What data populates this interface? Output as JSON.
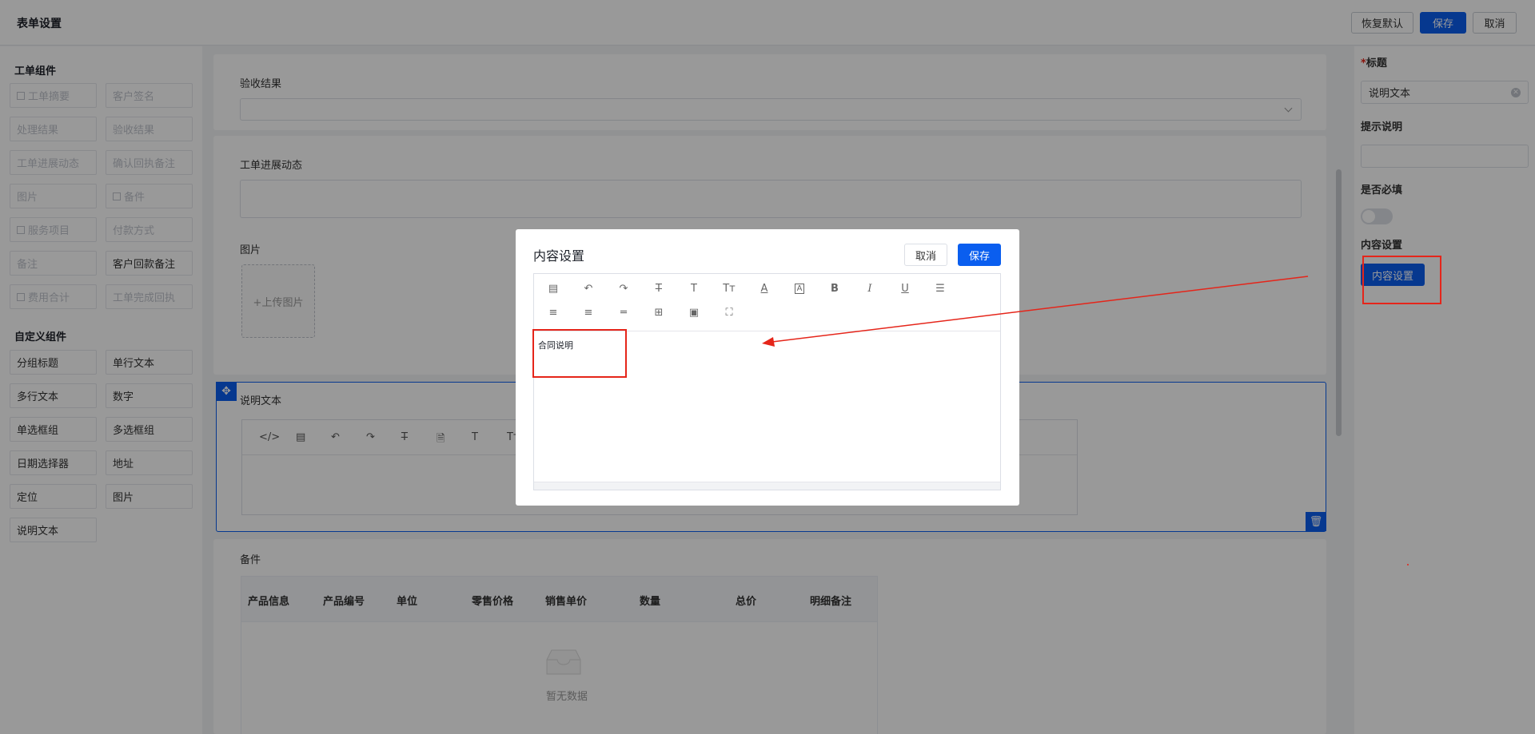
{
  "header": {
    "title": "表单设置",
    "restore_label": "恢复默认",
    "save_label": "保存",
    "cancel_label": "取消"
  },
  "left": {
    "workorder_section": "工单组件",
    "workorder_items": [
      {
        "label": "工单摘要",
        "disabled": true,
        "icon": true
      },
      {
        "label": "客户签名",
        "disabled": true,
        "icon": false
      },
      {
        "label": "处理结果",
        "disabled": true,
        "icon": false
      },
      {
        "label": "验收结果",
        "disabled": true,
        "icon": false
      },
      {
        "label": "工单进展动态",
        "disabled": true,
        "icon": false
      },
      {
        "label": "确认回执备注",
        "disabled": true,
        "icon": false
      },
      {
        "label": "图片",
        "disabled": true,
        "icon": false
      },
      {
        "label": "备件",
        "disabled": true,
        "icon": true
      },
      {
        "label": "服务项目",
        "disabled": true,
        "icon": true
      },
      {
        "label": "付款方式",
        "disabled": true,
        "icon": false
      },
      {
        "label": "备注",
        "disabled": true,
        "icon": false
      },
      {
        "label": "客户回款备注",
        "disabled": false,
        "icon": false
      },
      {
        "label": "费用合计",
        "disabled": true,
        "icon": true
      },
      {
        "label": "工单完成回执",
        "disabled": true,
        "icon": false
      }
    ],
    "custom_section": "自定义组件",
    "custom_items": [
      "分组标题",
      "单行文本",
      "多行文本",
      "数字",
      "单选框组",
      "多选框组",
      "日期选择器",
      "地址",
      "定位",
      "图片",
      "说明文本"
    ]
  },
  "canvas": {
    "acceptance_label": "验收结果",
    "progress_label": "工单进展动态",
    "image_label": "图片",
    "upload_label": "+上传图片",
    "desc_label": "说明文本",
    "parts_label": "备件",
    "table_headers": [
      "产品信息",
      "产品编号",
      "单位",
      "零售价格",
      "销售单价",
      "数量",
      "总价",
      "明细备注"
    ],
    "empty_text": "暂无数据"
  },
  "right": {
    "title_label": "标题",
    "title_value": "说明文本",
    "hint_label": "提示说明",
    "hint_value": "",
    "required_label": "是否必填",
    "required_on": false,
    "content_label": "内容设置",
    "content_button": "内容设置"
  },
  "dialog": {
    "title": "内容设置",
    "cancel_label": "取消",
    "save_label": "保存",
    "content_text": "合同说明",
    "toolbar_icons": [
      "template-icon",
      "undo-icon",
      "redo-icon",
      "strikethrough-icon",
      "font-size-icon",
      "clear-format-icon",
      "font-color-icon",
      "background-color-icon",
      "bold-icon",
      "italic-icon",
      "underline-icon",
      "align-left-icon",
      "align-center-icon",
      "align-right-icon",
      "horizontal-rule-icon",
      "table-icon",
      "image-icon",
      "fullscreen-icon"
    ]
  },
  "colors": {
    "primary": "#0a5eef",
    "annotation": "#e5251a"
  }
}
